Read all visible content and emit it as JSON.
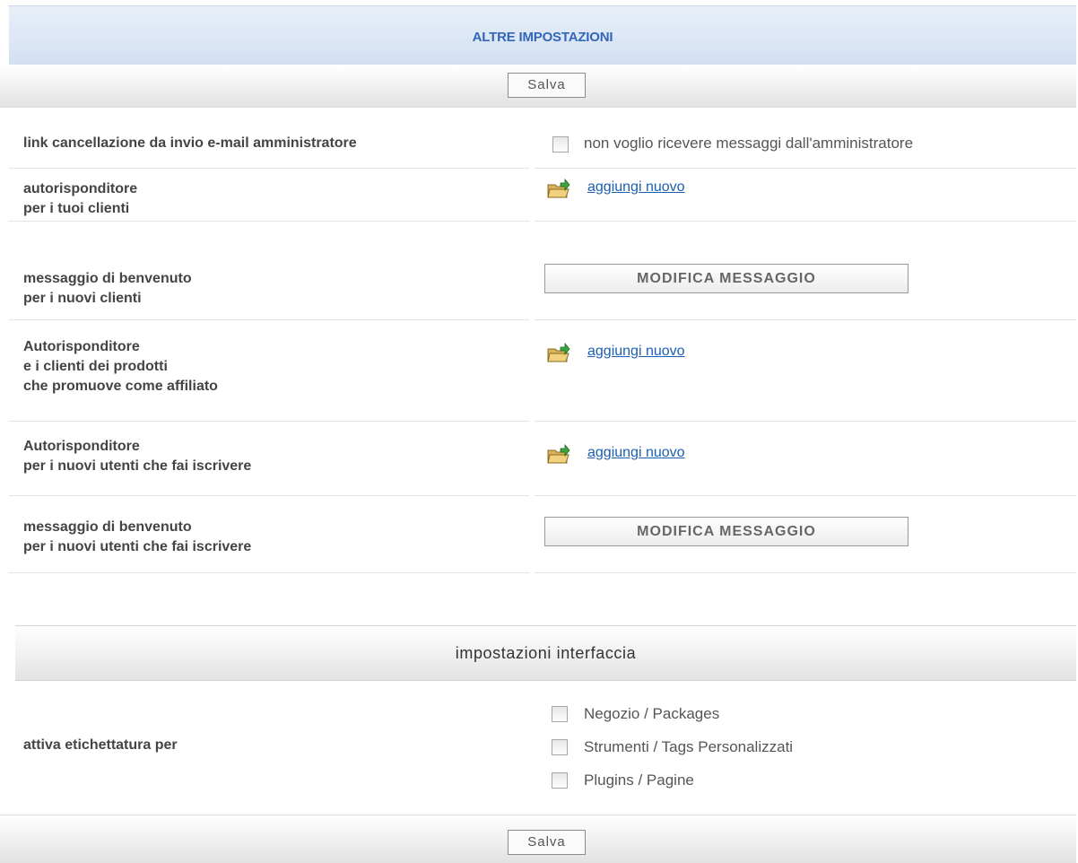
{
  "header": {
    "title": "ALTRE IMPOSTAZIONI"
  },
  "save_label": "Salva",
  "rows": [
    {
      "label": "link cancellazione da invio e-mail amministratore",
      "option": "non voglio ricevere messaggi dall'amministratore"
    },
    {
      "label_lines": [
        "autorisponditore",
        "per i tuoi clienti"
      ],
      "link": "aggiungi nuovo"
    },
    {
      "label_lines": [
        "messaggio di benvenuto",
        "per i nuovi clienti"
      ],
      "button": "MODIFICA MESSAGGIO"
    },
    {
      "label_lines": [
        "Autorisponditore",
        "e i clienti dei prodotti",
        "che promuove come affiliato"
      ],
      "link": "aggiungi nuovo"
    },
    {
      "label_lines": [
        "Autorisponditore",
        "per i nuovi utenti che fai iscrivere"
      ],
      "link": "aggiungi nuovo"
    },
    {
      "label_lines": [
        "messaggio di benvenuto",
        "per i nuovi utenti che fai iscrivere"
      ],
      "button": "MODIFICA MESSAGGIO"
    }
  ],
  "interface_section": {
    "title": "impostazioni interfaccia",
    "label": "attiva etichettatura per",
    "options": [
      "Negozio / Packages",
      "Strumenti / Tags Personalizzati",
      "Plugins / Pagine"
    ]
  },
  "colors": {
    "header_title": "#3466b8",
    "link": "#1b5fb3"
  },
  "icons": {
    "add": "folder-add-icon"
  }
}
